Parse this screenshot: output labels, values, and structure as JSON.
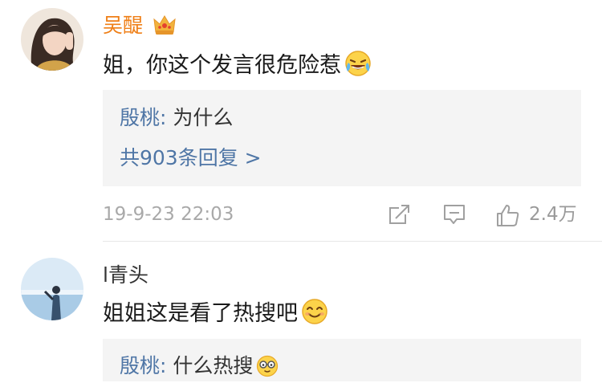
{
  "comments": [
    {
      "username": "吴醍",
      "text": "姐，你这个发言很危险惹",
      "reply": {
        "author": "殷桃:",
        "body": " 为什么",
        "more": "共903条回复 >"
      },
      "timestamp": "19-9-23 22:03",
      "likes": "2.4万",
      "icons": [
        "crown-badge-icon",
        "laughing-tears-emoji",
        "share-icon",
        "comment-icon",
        "like-icon"
      ]
    },
    {
      "username": "l青头",
      "text": "姐姐这是看了热搜吧",
      "reply": {
        "author": "殷桃:",
        "body": " 什么热搜"
      },
      "icons": [
        "smile-emoji",
        "glasses-emoji"
      ]
    }
  ],
  "colors": {
    "vip_name": "#ef7f17",
    "normal_name": "#333333",
    "link": "#4f76a6",
    "reply_bg": "#f4f4f4",
    "meta_gray": "#a9a9a9"
  }
}
